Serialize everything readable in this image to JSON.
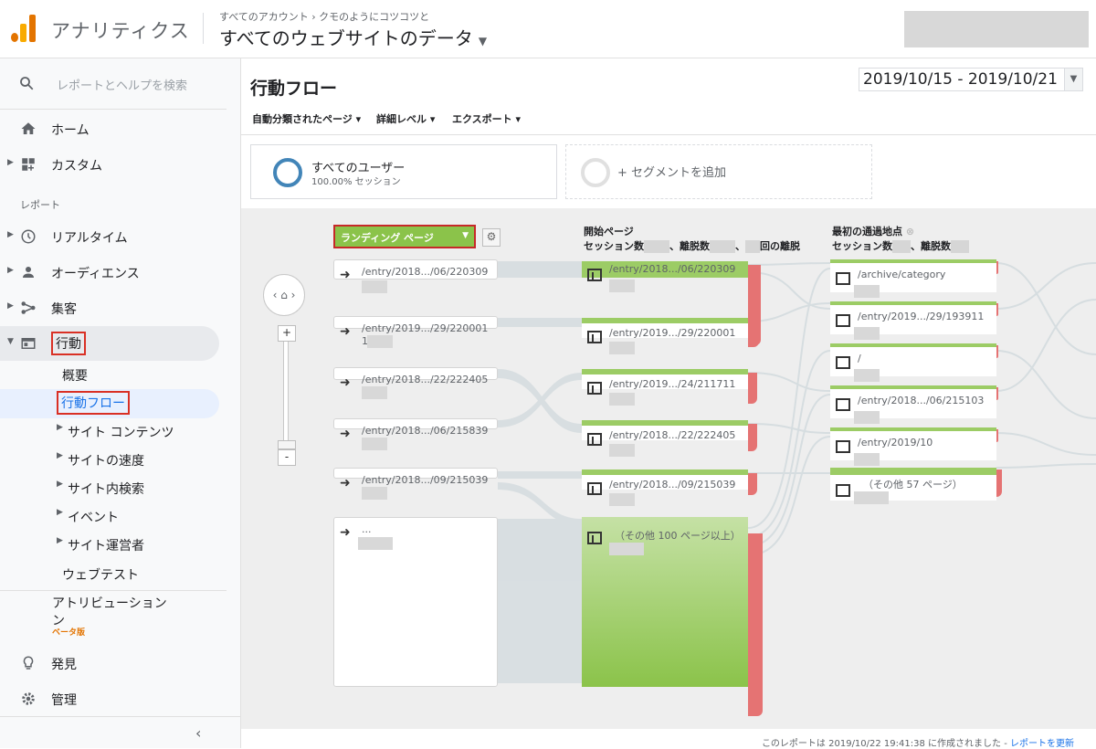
{
  "header": {
    "app_title": "アナリティクス",
    "breadcrumb": "すべてのアカウント › クモのようにコツコツと",
    "property": "すべてのウェブサイトのデータ"
  },
  "sidebar": {
    "search_placeholder": "レポートとヘルプを検索",
    "home": "ホーム",
    "custom": "カスタム",
    "reports_label": "レポート",
    "realtime": "リアルタイム",
    "audience": "オーディエンス",
    "acquisition": "集客",
    "behavior": "行動",
    "behavior_sub": {
      "overview": "概要",
      "flow": "行動フロー",
      "site_content": "サイト コンテンツ",
      "site_speed": "サイトの速度",
      "site_search": "サイト内検索",
      "events": "イベント",
      "publisher": "サイト運営者",
      "experiments": "ウェブテスト"
    },
    "attribution": "アトリビューション",
    "attribution_tail": "ン",
    "beta": "ベータ版",
    "discover": "発見",
    "admin": "管理"
  },
  "main": {
    "title": "行動フロー",
    "date_range": "2019/10/15 - 2019/10/21",
    "toolbar": {
      "auto_pages": "自動分類されたページ",
      "detail_level": "詳細レベル",
      "export": "エクスポート"
    },
    "segment": {
      "name": "すべてのユーザー",
      "sub": "100.00% セッション",
      "add": "+ セグメントを追加"
    },
    "flow": {
      "landing_dropdown": "ランディング ページ",
      "start_col_title": "開始ページ",
      "start_col_sub_a": "セッション数",
      "start_col_sub_b": "、離脱数",
      "start_col_sub_c": "回の離脱",
      "first_col_title": "最初の通過地点",
      "first_col_sub_a": "セッション数",
      "first_col_sub_b": "、離脱数",
      "landing": [
        {
          "label": "/entry/2018.../06/220309"
        },
        {
          "label": "/entry/2019.../29/220001",
          "count_prefix": "1"
        },
        {
          "label": "/entry/2018.../22/222405"
        },
        {
          "label": "/entry/2018.../06/215839"
        },
        {
          "label": "/entry/2018.../09/215039"
        },
        {
          "label": "..."
        }
      ],
      "start": [
        {
          "label": "/entry/2018.../06/220309"
        },
        {
          "label": "/entry/2019.../29/220001"
        },
        {
          "label": "/entry/2019.../24/211711"
        },
        {
          "label": "/entry/2018.../22/222405"
        },
        {
          "label": "/entry/2018.../09/215039"
        },
        {
          "label": "（その他 100 ページ以上）"
        }
      ],
      "first": [
        {
          "label": "/archive/category"
        },
        {
          "label": "/entry/2019.../29/193911"
        },
        {
          "label": "/"
        },
        {
          "label": "/entry/2018.../06/215103"
        },
        {
          "label": "/entry/2019/10"
        },
        {
          "label": "（その他 57 ページ）"
        }
      ]
    },
    "footer": {
      "text": "このレポートは 2019/10/22 19:41:38 に作成されました - ",
      "link": "レポートを更新"
    }
  },
  "colors": {
    "node_green": "#8bc34a",
    "dropoff_red": "#e57373",
    "segment_blue": "#4285b8",
    "highlight_red": "#d93025"
  }
}
